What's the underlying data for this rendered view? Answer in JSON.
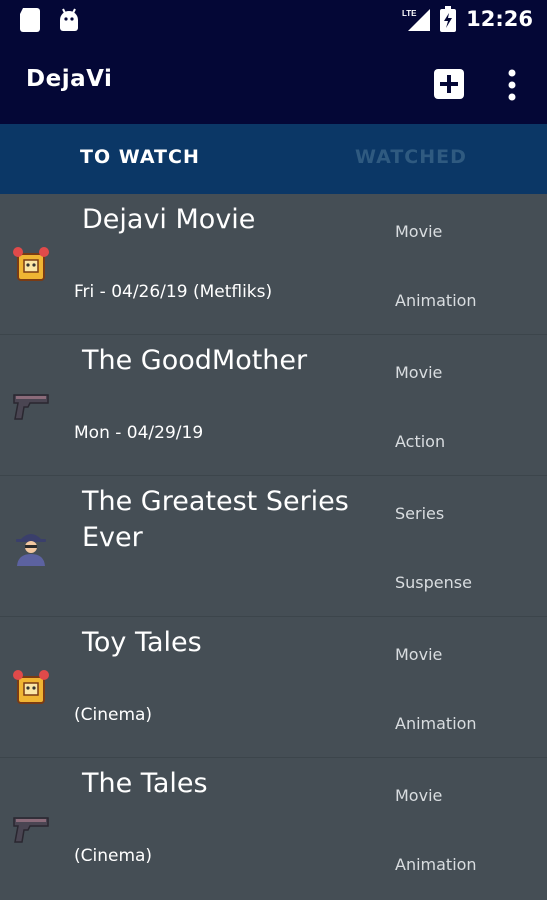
{
  "status_bar": {
    "network": "LTE",
    "time": "12:26"
  },
  "app_bar": {
    "title": "DejaVi",
    "add_icon": "add-box-icon",
    "menu_icon": "more-vert-icon"
  },
  "tabs": [
    {
      "label": "TO WATCH",
      "active": true
    },
    {
      "label": "WATCHED",
      "active": false
    }
  ],
  "items": [
    {
      "title": "Dejavi Movie",
      "subtitle": "Fri - 04/26/19 (Metfliks)",
      "type": "Movie",
      "genre": "Animation",
      "icon": "toy-icon"
    },
    {
      "title": "The GoodMother",
      "subtitle": "Mon - 04/29/19",
      "type": "Movie",
      "genre": "Action",
      "icon": "pistol-icon"
    },
    {
      "title": "The Greatest Series Ever",
      "subtitle": "",
      "type": "Series",
      "genre": "Suspense",
      "icon": "detective-icon"
    },
    {
      "title": "Toy Tales",
      "subtitle": "(Cinema)",
      "type": "Movie",
      "genre": "Animation",
      "icon": "toy-icon"
    },
    {
      "title": "The Tales",
      "subtitle": "(Cinema)",
      "type": "Movie",
      "genre": "Animation",
      "icon": "pistol-icon"
    }
  ],
  "colors": {
    "bar": "#040736",
    "tabs": "#0b3766",
    "list_bg": "#454e55",
    "inactive_tab": "#2f5a80"
  }
}
